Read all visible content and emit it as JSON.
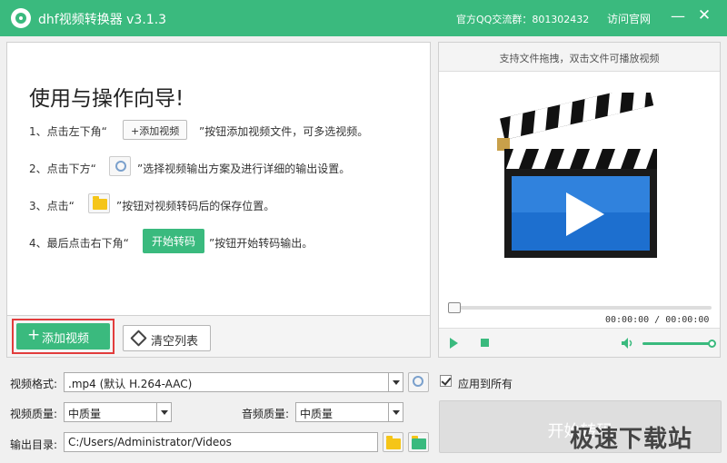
{
  "titlebar": {
    "app_title": "dhf视频转换器 v3.1.3",
    "qq_group": "官方QQ交流群：801302432",
    "website_link": "访问官网",
    "minimize": "—",
    "close": "✕"
  },
  "guide": {
    "title": "使用与操作向导!",
    "step1_before": "1、点击左下角“",
    "step1_button": "+添加视频",
    "step1_after": "”按钮添加视频文件，可多选视频。",
    "step2_before": "2、点击下方“",
    "step2_after": "”选择视频输出方案及进行详细的输出设置。",
    "step3_before": "3、点击“",
    "step3_after": "”按钮对视频转码后的保存位置。",
    "step4_before": "4、最后点击右下角“",
    "step4_button": "开始转码",
    "step4_after": "”按钮开始转码输出。"
  },
  "toolbar": {
    "add_video": "添加视频",
    "clear_list": "清空列表"
  },
  "preview": {
    "hint": "支持文件拖拽，双击文件可播放视频",
    "time": "00:00:00 / 00:00:00",
    "progress": 0,
    "volume": 1.0
  },
  "settings": {
    "format_label": "视频格式:",
    "format_value": ".mp4 (默认 H.264-AAC)",
    "apply_all": "应用到所有",
    "apply_all_checked": true,
    "video_quality_label": "视频质量:",
    "video_quality_value": "中质量",
    "audio_quality_label": "音频质量:",
    "audio_quality_value": "中质量",
    "output_label": "输出目录:",
    "output_value": "C:/Users/Administrator/Videos",
    "start_button": "开始转码"
  },
  "watermark": "极速下载站",
  "colors": {
    "accent": "#3aba7e",
    "highlight": "#e23c3c"
  },
  "icons": [
    "logo-icon",
    "plus-icon",
    "eraser-icon",
    "settings-icon",
    "folder-icon",
    "clapperboard-icon",
    "play-icon",
    "stop-icon",
    "volume-icon",
    "open-folder-icon",
    "checkbox-icon"
  ]
}
